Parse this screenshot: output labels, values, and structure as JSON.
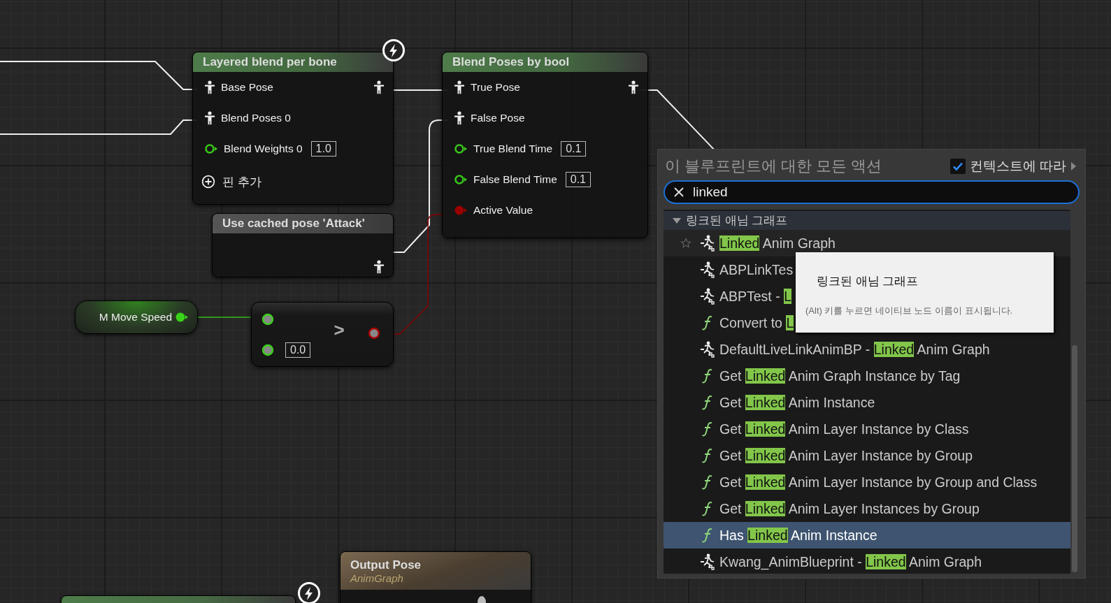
{
  "graph": {
    "nodes": [
      {
        "kind": "blend",
        "title": "Layered blend per bone",
        "color": "#4e7c4a",
        "event": true,
        "inputs": [
          {
            "kind": "pose",
            "label": "Base Pose"
          },
          {
            "kind": "pose",
            "label": "Blend Poses 0"
          },
          {
            "kind": "float",
            "label": "Blend Weights 0",
            "value": "1.0"
          }
        ],
        "outputs": [
          {
            "kind": "pose"
          }
        ],
        "add_pin": "핀 추가"
      },
      {
        "kind": "blend",
        "title": "Blend Poses by bool",
        "color": "#4e7c4a",
        "event": false,
        "inputs": [
          {
            "kind": "pose",
            "label": "True Pose"
          },
          {
            "kind": "pose",
            "label": "False Pose"
          },
          {
            "kind": "float",
            "label": "True Blend Time",
            "value": "0.1"
          },
          {
            "kind": "float",
            "label": "False Blend Time",
            "value": "0.1"
          },
          {
            "kind": "bool",
            "label": "Active Value"
          }
        ],
        "outputs": [
          {
            "kind": "pose"
          }
        ]
      },
      {
        "kind": "blend",
        "title": "Use cached pose 'Attack'",
        "color": "#555555",
        "event": false,
        "outputs": [
          {
            "kind": "pose"
          }
        ]
      },
      {
        "kind": "variable",
        "label": "M Move Speed",
        "color": "#39d21a"
      },
      {
        "kind": "compare",
        "operator": ">",
        "inputs": [
          {
            "kind": "float"
          },
          {
            "kind": "float",
            "value": "0.0"
          }
        ],
        "outputs": [
          {
            "kind": "bool"
          }
        ]
      },
      {
        "kind": "result",
        "title": "Output Pose",
        "subtitle": "AnimGraph",
        "color": "#7a6850"
      },
      {
        "kind": "blend",
        "color": "#4e7c4a",
        "event": true
      }
    ]
  },
  "action_menu": {
    "title": "이 블루프린트에 대한 모든 액션",
    "context_sensitive": {
      "label": "컨텍스트에 따라",
      "checked": true
    },
    "search": {
      "value": "linked"
    },
    "category": {
      "label": "링크된 애님 그래프",
      "expanded": true
    },
    "items": [
      {
        "kind": "node",
        "match": "Linked",
        "suffix": " Anim Graph",
        "hovered": true,
        "selected": false,
        "favorite": false
      },
      {
        "kind": "node",
        "prefix": "ABPLinkTes",
        "hovered": false,
        "selected": false
      },
      {
        "kind": "node",
        "prefix": "ABPTest - ",
        "match": "L",
        "hovered": false,
        "selected": false
      },
      {
        "kind": "function",
        "prefix": "Convert to ",
        "match": "L",
        "hovered": false,
        "selected": false
      },
      {
        "kind": "node",
        "prefix": "DefaultLiveLinkAnimBP - ",
        "match": "Linked",
        "suffix": " Anim Graph",
        "hovered": false,
        "selected": false
      },
      {
        "kind": "function",
        "prefix": "Get ",
        "match": "Linked",
        "suffix": " Anim Graph Instance by Tag",
        "hovered": false,
        "selected": false
      },
      {
        "kind": "function",
        "prefix": "Get ",
        "match": "Linked",
        "suffix": " Anim Instance",
        "hovered": false,
        "selected": false
      },
      {
        "kind": "function",
        "prefix": "Get ",
        "match": "Linked",
        "suffix": " Anim Layer Instance by Class",
        "hovered": false,
        "selected": false
      },
      {
        "kind": "function",
        "prefix": "Get ",
        "match": "Linked",
        "suffix": " Anim Layer Instance by Group",
        "hovered": false,
        "selected": false
      },
      {
        "kind": "function",
        "prefix": "Get ",
        "match": "Linked",
        "suffix": " Anim Layer Instance by Group and Class",
        "hovered": false,
        "selected": false
      },
      {
        "kind": "function",
        "prefix": "Get ",
        "match": "Linked",
        "suffix": " Anim Layer Instances by Group",
        "hovered": false,
        "selected": false
      },
      {
        "kind": "function",
        "prefix": "Has ",
        "match": "Linked",
        "suffix": " Anim Instance",
        "hovered": false,
        "selected": true
      },
      {
        "kind": "node",
        "prefix": "Kwang_AnimBlueprint - ",
        "match": "Linked",
        "suffix": " Anim Graph",
        "hovered": false,
        "selected": false
      }
    ],
    "tooltip": {
      "title": "링크된 애님 그래프",
      "hint": "(Alt) 키를 누르면 네이티브 노드 이름이 표시됩니다."
    }
  }
}
